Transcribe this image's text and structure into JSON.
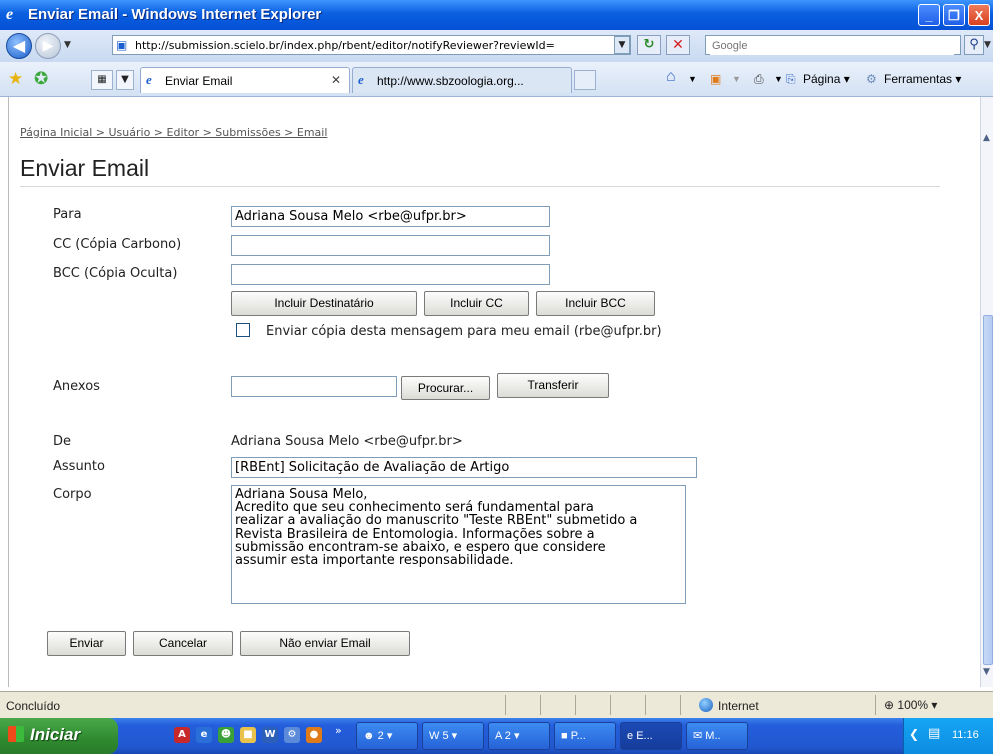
{
  "window": {
    "title": "Enviar Email - Windows Internet Explorer",
    "minimize": "_",
    "maximize": "❐",
    "close": "X"
  },
  "address_bar": {
    "url": "http://submission.scielo.br/index.php/rbent/editor/notifyReviewer?reviewId=",
    "search_placeholder": "Google"
  },
  "tabs": [
    {
      "label": "Enviar Email",
      "active": true
    },
    {
      "label": "http://www.sbzoologia.org...",
      "active": false
    }
  ],
  "commands": {
    "pagina": "Página ▾",
    "ferramentas": "Ferramentas ▾"
  },
  "breadcrumb": "Página Inicial > Usuário > Editor > Submissões > Email",
  "page_title": "Enviar Email",
  "form": {
    "to_label": "Para",
    "to_value": "Adriana Sousa Melo <rbe@ufpr.br>",
    "cc_label": "CC (Cópia Carbono)",
    "cc_value": "",
    "bcc_label": "BCC (Cópia Oculta)",
    "bcc_value": "",
    "add_recipient": "Incluir Destinatário",
    "add_cc": "Incluir CC",
    "add_bcc": "Incluir BCC",
    "copy_checkbox_label": "Enviar cópia desta mensagem para meu email (rbe@ufpr.br)",
    "attachments_label": "Anexos",
    "browse": "Procurar...",
    "upload": "Transferir",
    "from_label": "De",
    "from_value": "Adriana Sousa Melo <rbe@ufpr.br>",
    "subject_label": "Assunto",
    "subject_value": "[RBEnt] Solicitação de Avaliação de Artigo",
    "body_label": "Corpo",
    "body_lines": [
      "Adriana Sousa Melo,",
      "",
      "Acredito que seu conhecimento será fundamental para",
      "realizar a avaliação do manuscrito \"Teste RBEnt\" submetido a",
      "Revista Brasileira de Entomologia. Informações sobre a",
      "submissão encontram-se abaixo, e espero que considere",
      "assumir esta importante responsabilidade."
    ],
    "send": "Enviar",
    "cancel": "Cancelar",
    "skip": "Não enviar Email"
  },
  "status_bar": {
    "text": "Concluído",
    "zone": "Internet",
    "zoom": "100%"
  },
  "taskbar": {
    "start": "Iniciar",
    "items": [
      {
        "label": "2",
        "icon": "chat-icon"
      },
      {
        "label": "5",
        "icon": "word-icon"
      },
      {
        "label": "2",
        "icon": "acrobat-icon"
      },
      {
        "label": "P...",
        "icon": "folder-icon"
      },
      {
        "label": "E...",
        "icon": "ie-icon"
      },
      {
        "label": "M..",
        "icon": "mail-icon"
      }
    ],
    "clock": "11:16"
  },
  "colors": {
    "titlebar": "#0a5fe0",
    "taskbar": "#245edc",
    "start_button": "#2f8a2f"
  }
}
